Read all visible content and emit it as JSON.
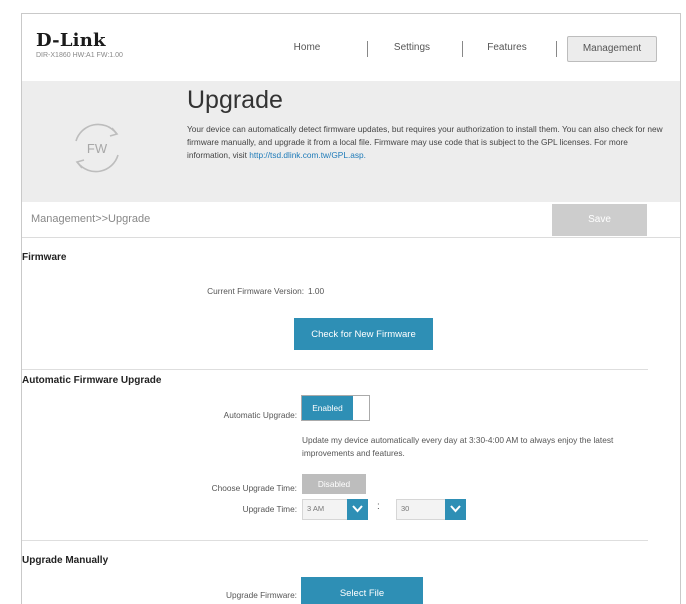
{
  "header": {
    "brand": "D-Link",
    "model": "DIR-X1860 HW:A1 FW:1.00",
    "nav": [
      {
        "label": "Home"
      },
      {
        "label": "Settings"
      },
      {
        "label": "Features"
      },
      {
        "label": "Management",
        "active": true
      }
    ]
  },
  "banner": {
    "icon_text": "FW",
    "title": "Upgrade",
    "description": "Your device can automatically detect firmware updates, but requires your authorization to install them. You can also check for new firmware manually, and upgrade it from a local file. Firmware may use code that is subject to the GPL licenses. For more information, visit",
    "link_text": "http://tsd.dlink.com.tw/GPL.asp."
  },
  "breadcrumb": {
    "path": "Management>>Upgrade",
    "save_label": "Save"
  },
  "firmware": {
    "section_title": "Firmware",
    "current_version_label": "Current Firmware Version:",
    "current_version_value": "1.00",
    "check_button": "Check for New Firmware"
  },
  "auto_upgrade": {
    "section_title": "Automatic Firmware Upgrade",
    "auto_label": "Automatic Upgrade:",
    "auto_state": "Enabled",
    "auto_note": "Update my device automatically every day at 3:30-4:00 AM to always enjoy the latest improvements and features.",
    "choose_time_label": "Choose Upgrade Time:",
    "choose_time_state": "Disabled",
    "upgrade_time_label": "Upgrade Time:",
    "hour_value": "3 AM",
    "minute_value": "30",
    "colon": ":"
  },
  "manual": {
    "section_title": "Upgrade Manually",
    "upgrade_firmware_label": "Upgrade Firmware:",
    "select_file_button": "Select File"
  },
  "colors": {
    "accent": "#2e8fb5",
    "banner_bg": "#ededed",
    "link": "#1d7ab8"
  }
}
